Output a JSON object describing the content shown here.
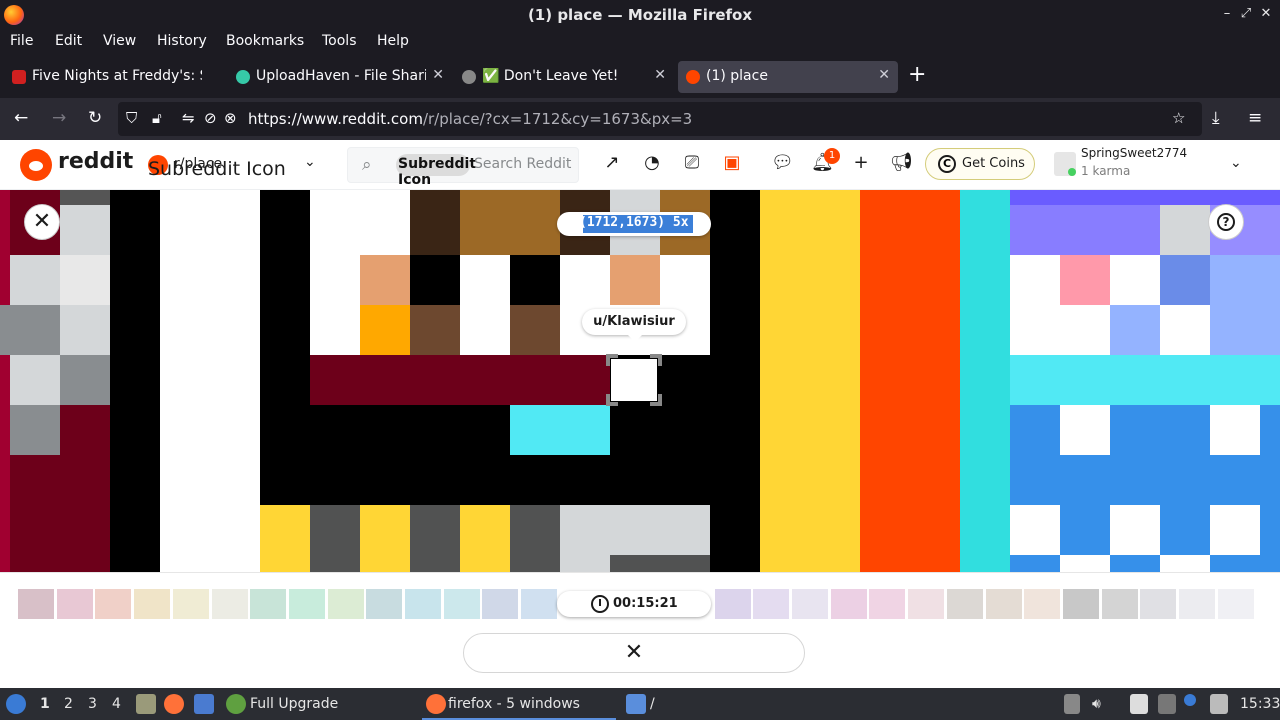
{
  "window": {
    "title": "(1) place — Mozilla Firefox",
    "controls": [
      "–",
      "✕"
    ]
  },
  "menu": [
    "File",
    "Edit",
    "View",
    "History",
    "Bookmarks",
    "Tools",
    "Help"
  ],
  "tabs": [
    {
      "label": "Five Nights at Freddy's: S",
      "icon_color": "#d02020",
      "active": false
    },
    {
      "label": "UploadHaven - File Sharin",
      "icon_color": "#36c9a8",
      "active": false
    },
    {
      "label": "✅ Don't Leave Yet!",
      "icon_color": "#888888",
      "active": false
    },
    {
      "label": "(1) place",
      "icon_color": "#ff4500",
      "active": true
    }
  ],
  "nav": {
    "url_host": "https://www.reddit.com",
    "url_path": "/r/place/?cx=1712&cy=1673&px=3"
  },
  "reddit": {
    "brand": "reddit",
    "subreddit": "r/place",
    "subreddit_icon_alt": "Subreddit Icon",
    "search_chip": "Subreddit Icon",
    "search_placeholder": "Search Reddit",
    "notifications_count": "1",
    "get_coins": "Get Coins",
    "username": "SpringSweet2774",
    "karma": "1 karma"
  },
  "place": {
    "coords": "(1712,1673) 5x",
    "pixel_user": "u/Klawisiur",
    "timer": "00:15:21",
    "palette": [
      "#d8c0c8",
      "#e8c8d4",
      "#f0d0c8",
      "#f0e4c8",
      "#f0ecd4",
      "#ecece4",
      "#c8e4d8",
      "#c8ecdc",
      "#dcecd4",
      "#c8dce0",
      "#c8e4ec",
      "#cce8ec",
      "#d0d8e8",
      "#d0e0f0",
      "#ffffff",
      "#ffffff",
      "#ffffff",
      "#ffffff",
      "#dcd4ec",
      "#e4dcf0",
      "#e8e4f0",
      "#ecd0e4",
      "#f0d4e4",
      "#f0e0e4",
      "#dcd8d4",
      "#e4dcd4",
      "#f0e4dc",
      "#c8c8c8",
      "#d4d4d4",
      "#e0e0e4",
      "#ececf0",
      "#f0f0f4"
    ]
  },
  "taskbar": {
    "workspaces": [
      "1",
      "2",
      "3",
      "4"
    ],
    "upgrade": "Full Upgrade",
    "firefox": "firefox - 5 windows",
    "folder": "/",
    "clock": "15:33"
  }
}
